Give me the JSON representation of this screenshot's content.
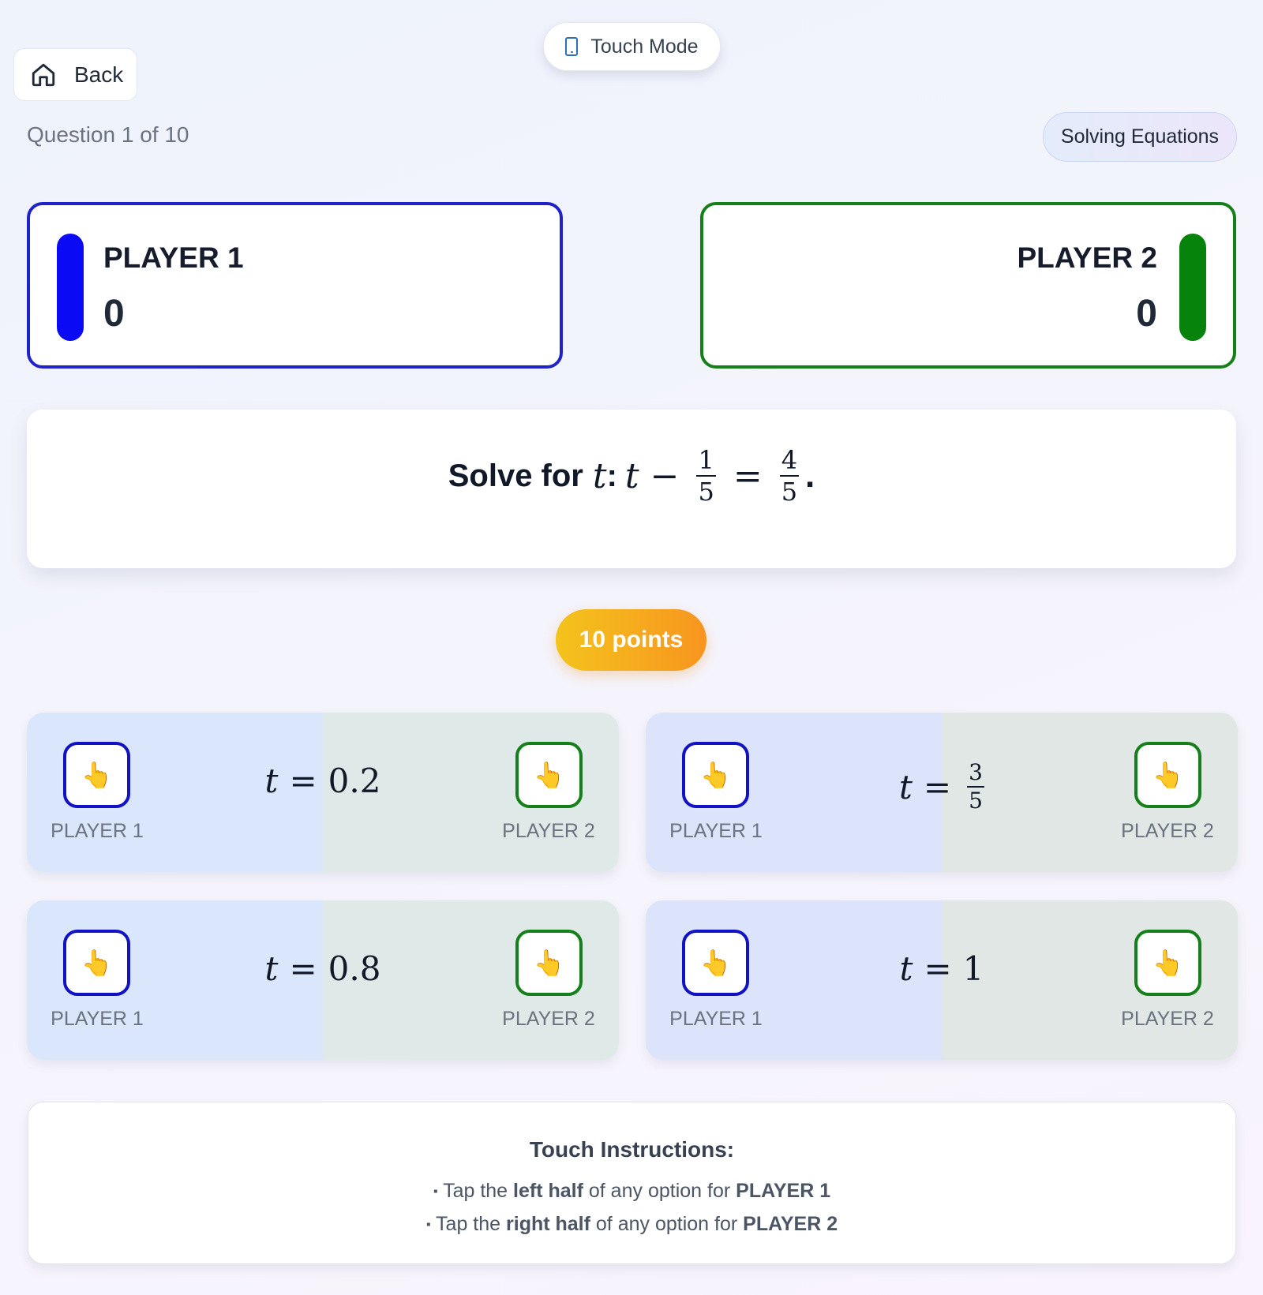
{
  "header": {
    "touch_mode_label": "Touch Mode",
    "back_label": "Back",
    "question_counter": "Question 1 of 10",
    "topic": "Solving Equations"
  },
  "players": [
    {
      "name": "PLAYER 1",
      "score": "0",
      "color": "#0a0af4"
    },
    {
      "name": "PLAYER 2",
      "score": "0",
      "color": "#06830a"
    }
  ],
  "question": {
    "lead": "Solve for",
    "variable": "t",
    "colon": ":",
    "lhs_var": "t",
    "minus": "−",
    "frac1_num": "1",
    "frac1_den": "5",
    "equals": "=",
    "frac2_num": "4",
    "frac2_den": "5",
    "period": "."
  },
  "points_label": "10 points",
  "options": [
    {
      "var": "t",
      "eq": "=",
      "value": "0.2"
    },
    {
      "var": "t",
      "eq": "=",
      "frac_num": "3",
      "frac_den": "5"
    },
    {
      "var": "t",
      "eq": "=",
      "value": "0.8"
    },
    {
      "var": "t",
      "eq": "=",
      "value": "1"
    }
  ],
  "tap": {
    "icon": "👆",
    "left_label": "PLAYER 1",
    "right_label": "PLAYER 2"
  },
  "instructions": {
    "title": "Touch Instructions:",
    "line1": {
      "bullet": "▪",
      "pre": "Tap the",
      "bold1": "left half",
      "mid": "of any option for",
      "bold2": "PLAYER 1"
    },
    "line2": {
      "bullet": "▪",
      "pre": "Tap the",
      "bold1": "right half",
      "mid": "of any option for",
      "bold2": "PLAYER 2"
    }
  },
  "colors": {
    "player1": "#1e22c8",
    "player2": "#157f19",
    "points_gradient_start": "#f4c31c",
    "points_gradient_end": "#f7951f"
  }
}
